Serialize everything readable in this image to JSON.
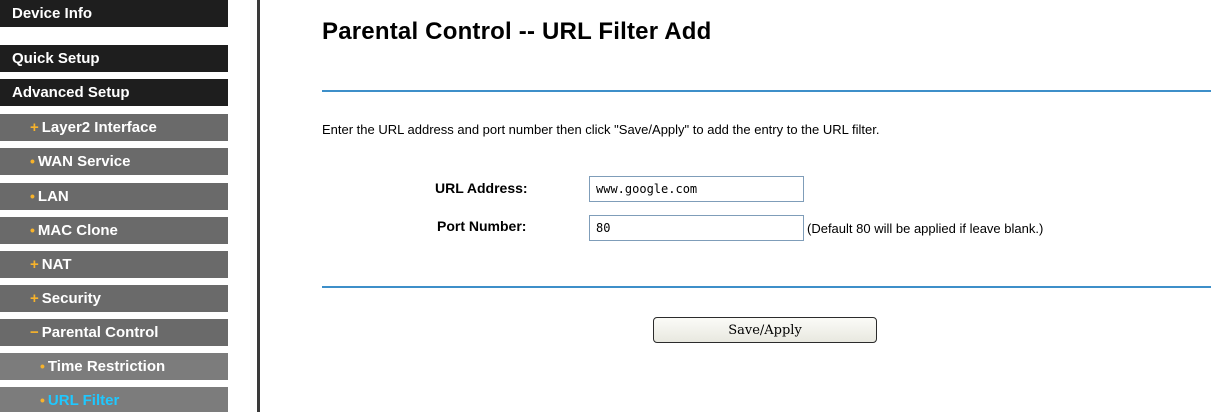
{
  "sidebar": {
    "items": [
      {
        "label": "Device Info"
      },
      {
        "label": "Quick Setup"
      },
      {
        "label": "Advanced Setup"
      },
      {
        "label": "Layer2 Interface",
        "bullet": "+"
      },
      {
        "label": "WAN Service",
        "bullet": "•"
      },
      {
        "label": "LAN",
        "bullet": "•"
      },
      {
        "label": "MAC Clone",
        "bullet": "•"
      },
      {
        "label": "NAT",
        "bullet": "+"
      },
      {
        "label": "Security",
        "bullet": "+"
      },
      {
        "label": "Parental Control",
        "bullet": "−"
      },
      {
        "label": "Time Restriction",
        "bullet": "•"
      },
      {
        "label": "URL Filter",
        "bullet": "•"
      }
    ],
    "colors": {
      "top_bg": "#1e1e1e",
      "sub_bg": "#6a6a6a",
      "subsub_bg": "#7c7c7c",
      "bullet": "#f7b32b",
      "active_text": "#1fc8ff"
    }
  },
  "main": {
    "title": "Parental Control -- URL Filter Add",
    "description": "Enter the URL address and port number then click \"Save/Apply\" to add the entry to the URL filter.",
    "url_field": {
      "label": "URL Address:",
      "value": "www.google.com"
    },
    "port_field": {
      "label": "Port Number:",
      "value": "80",
      "hint": "(Default 80 will be applied if leave blank.)"
    },
    "save_button": {
      "label": "Save/Apply"
    },
    "divider_color": "#3d8fc9"
  }
}
